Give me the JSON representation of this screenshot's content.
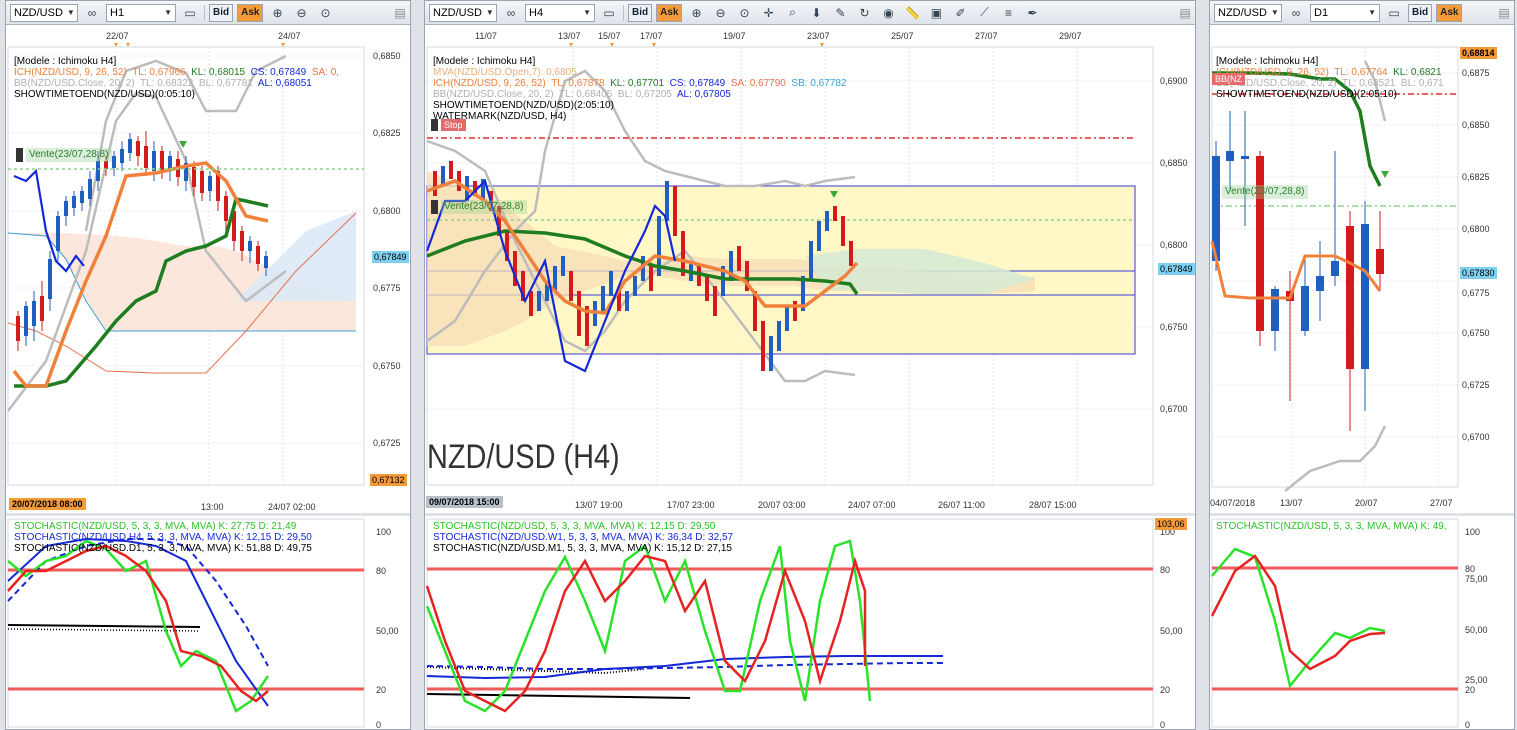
{
  "panel1": {
    "symbol": "NZD/USD",
    "timeframe": "H1",
    "bid": "Bid",
    "ask": "Ask",
    "top_dates": [
      "22/07",
      "24/07"
    ],
    "prices": [
      "0,6850",
      "0,6825",
      "0,6800",
      "0,6775",
      "0,6750",
      "0,6725"
    ],
    "current_price": "0,67849",
    "bottom_price": "0,67132",
    "bottom_left_date": "20/07/2018 08:00",
    "bottom_times": [
      "13:00",
      "24/07 02:00"
    ],
    "overlay": {
      "l1": "[Modele : Ichimoku H4]",
      "l2a": "ICH(NZD/USD, 9, 26, 52)",
      "l2b": "TL: 0,67966",
      "l2c": "KL: 0,68015",
      "l2d": "CS: 0,67849",
      "l2e": "SA: 0,",
      "l3a": "BB(NZD/USD.Close, 20, 2)",
      "l3b": "TL: 0,68322",
      "l3c": "BL: 0,67781",
      "l3d": "AL: 0,68051",
      "l4": "SHOWTIMETOEND(NZD/USD)(0:05:10)"
    },
    "vente": "Vente(23/07,28,8)",
    "stoch": {
      "l1": "STOCHASTIC(NZD/USD, 5, 3, 3, MVA, MVA)  K: 27,75  D: 21,49",
      "l2": "STOCHASTIC(NZD/USD.H4, 5, 3, 3, MVA, MVA)  K: 12,15  D: 29,50",
      "l3": "STOCHASTIC(NZD/USD.D1, 5, 3, 3, MVA, MVA)  K: 51,88  D: 49,75",
      "levels": [
        "100",
        "80",
        "50,00",
        "20",
        "0"
      ]
    }
  },
  "panel2": {
    "symbol": "NZD/USD",
    "timeframe": "H4",
    "bid": "Bid",
    "ask": "Ask",
    "top_dates": [
      "11/07",
      "13/07",
      "15/07",
      "17/07",
      "19/07",
      "23/07",
      "25/07",
      "27/07",
      "29/07"
    ],
    "prices": [
      "0,6900",
      "0,6850",
      "0,6800",
      "0,6750",
      "0,6700"
    ],
    "current_price": "0,67849",
    "bottom_left_date": "09/07/2018 15:00",
    "bottom_times": [
      "13/07 19:00",
      "17/07 23:00",
      "20/07 03:00",
      "24/07 07:00",
      "26/07 11:00",
      "28/07 15:00"
    ],
    "overlay": {
      "l1": "[Modele : Ichimoku H4]",
      "l2": "MVA(NZD/USD.Open,7): 0,6805",
      "l3a": "ICH(NZD/USD, 9, 26, 52)",
      "l3b": "TL: 0,67878",
      "l3c": "KL: 0,67701",
      "l3d": "CS: 0,67849",
      "l3e": "SA: 0,67790",
      "l3f": "SB: 0,67782",
      "l4a": "BB(NZD/USD.Close, 20, 2)",
      "l4b": "TL: 0,68405",
      "l4c": "BL: 0,67205",
      "l4d": "AL: 0,67805",
      "l5": "SHOWTIMETOEND(NZD/USD)(2:05:10)",
      "l6": "WATERMARK(NZD/USD, H4)"
    },
    "stop": "Stop",
    "vente": "Vente(23/07,28,8)",
    "watermark": "NZD/USD (H4)",
    "stoch": {
      "l1": "STOCHASTIC(NZD/USD, 5, 3, 3, MVA, MVA)  K: 12,15  D: 29,50",
      "l2": "STOCHASTIC(NZD/USD.W1, 5, 3, 3, MVA, MVA)  K: 36,34  D: 32,57",
      "l3": "STOCHASTIC(NZD/USD.M1, 5, 3, 3, MVA, MVA)  K: 15,12  D: 27,15",
      "levels": [
        "100",
        "80",
        "50,00",
        "20",
        "0"
      ],
      "top_value": "103,06"
    }
  },
  "panel3": {
    "symbol": "NZD/USD",
    "timeframe": "D1",
    "bid": "Bid",
    "ask": "Ask",
    "prices": [
      "0,6875",
      "0,6850",
      "0,6825",
      "0,6800",
      "0,6775",
      "0,6750",
      "0,6725",
      "0,6700"
    ],
    "top_price": "0,68814",
    "current_price": "0,67830",
    "bottom_dates": [
      "04/07/2018",
      "13/07",
      "20/07",
      "27/07"
    ],
    "overlay": {
      "l1": "[Modele : Ichimoku H4]",
      "l2a": "ICH(NZD/USD, 9, 26, 52)",
      "l2b": "TL: 0,67764",
      "l2c": "KL: 0,6821",
      "l3a": "BB(NZD/USD.Close, 20, 2)",
      "l3b": "TL: 0,68521",
      "l3c": "BL: 0,671",
      "l4": "SHOWTIMETOEND(NZD/USD)(2:05:10)"
    },
    "bb_tag": "BB(NZ",
    "vente": "Vente(23/07,28,8)",
    "stoch": {
      "l1": "STOCHASTIC(NZD/USD, 5, 3, 3, MVA, MVA)  K: 49,",
      "levels": [
        "100",
        "80",
        "75,00",
        "50,00",
        "25,00",
        "20",
        "0"
      ]
    }
  },
  "colors": {
    "ichimoku_tenkan": "#f0813c",
    "ichimoku_kijun": "#1e7d1e",
    "bollinger": "#b7b7b7",
    "candle_up": "#1f5fbf",
    "candle_down": "#d41a1a",
    "stoch_k": "#29e229",
    "stoch_d": "#e62222",
    "level_line": "#ef5a5a",
    "ask_button": "#f39a3a"
  }
}
